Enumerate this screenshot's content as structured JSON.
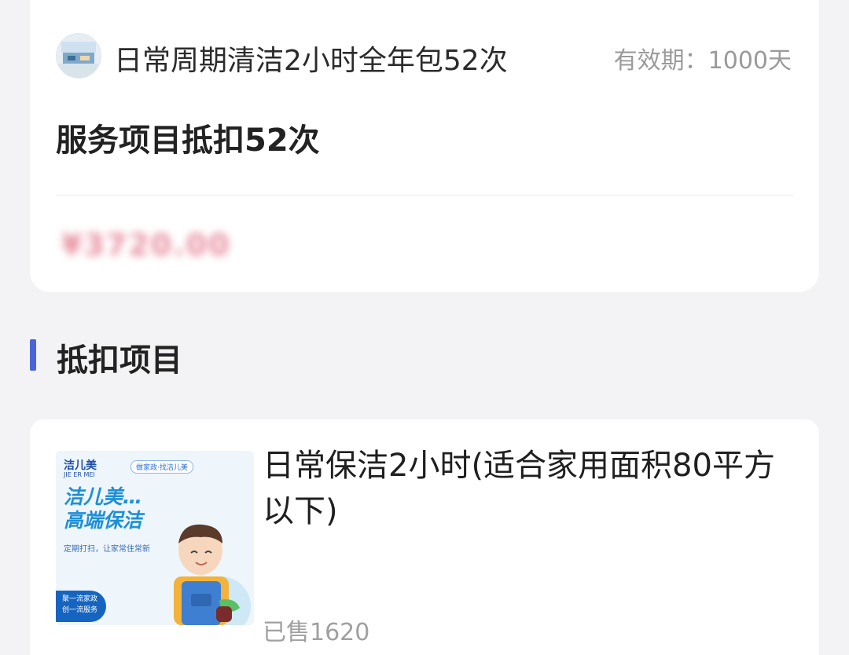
{
  "package": {
    "title": "日常周期清洁2小时全年包52次",
    "validity": "有效期：1000天",
    "deduct_title": "服务项目抵扣52次",
    "price_blurred": "¥3720.00"
  },
  "section": {
    "title": "抵扣项目"
  },
  "item": {
    "title": "日常保洁2小时(适合家用面积80平方以下)",
    "sold": "已售1620",
    "thumb": {
      "brand": "洁儿美",
      "brand_en": "JIE ER MEI",
      "tag": "做家政·找洁儿美",
      "headline_1": "洁儿美…",
      "headline_2": "高端保洁",
      "slogan": "定期打扫，让家常住常新",
      "badge_1": "聚一流家政",
      "badge_2": "创一流服务"
    }
  },
  "colors": {
    "accent": "#4a64d6",
    "background": "#f3f3f5",
    "card": "#ffffff",
    "muted_text": "#9a9a9a"
  }
}
